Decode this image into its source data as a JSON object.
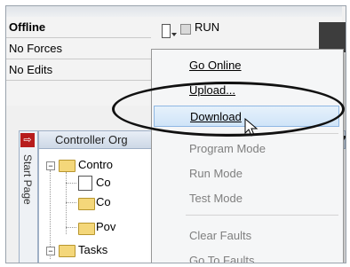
{
  "status": {
    "connection": "Offline",
    "forces": "No Forces",
    "edits": "No Edits",
    "run_label": "RUN"
  },
  "organizer": {
    "header": "Controller Org",
    "side_tab": "Start Page",
    "tree": [
      {
        "label": "Contro",
        "kind": "folder"
      },
      {
        "label": "Co",
        "kind": "doc"
      },
      {
        "label": "Co",
        "kind": "folder"
      },
      {
        "label": "Pov",
        "kind": "folder"
      },
      {
        "label": "Tasks",
        "kind": "folder"
      }
    ]
  },
  "menu": {
    "items": [
      {
        "label": "Go Online",
        "enabled": true
      },
      {
        "label": "Upload...",
        "enabled": true
      },
      {
        "label": "Download",
        "enabled": true,
        "highlighted": true
      },
      {
        "label": "Program Mode",
        "enabled": false
      },
      {
        "label": "Run Mode",
        "enabled": false
      },
      {
        "label": "Test Mode",
        "enabled": false
      },
      {
        "label": "Clear Faults",
        "enabled": false
      },
      {
        "label": "Go To Faults",
        "enabled": false
      }
    ]
  },
  "colors": {
    "highlight": "#cfe4f8",
    "highlight_border": "#8fb7e3",
    "disabled_text": "#7f7f7f",
    "side_icon": "#b71c1c"
  }
}
